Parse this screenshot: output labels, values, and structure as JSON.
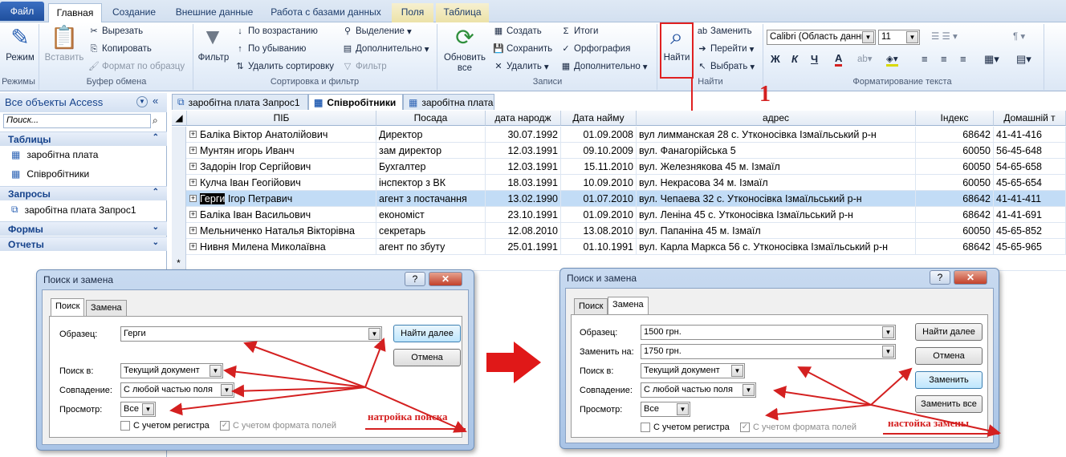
{
  "ribbon_tabs": [
    "Файл",
    "Главная",
    "Создание",
    "Внешние данные",
    "Работа с базами данных",
    "Поля",
    "Таблица"
  ],
  "ribbon": {
    "mode_label": "Режим",
    "paste_label": "Вставить",
    "cut": "Вырезать",
    "copy": "Копировать",
    "format_painter": "Формат по образцу",
    "filter_label": "Фильтр",
    "sort_asc": "По возрастанию",
    "sort_desc": "По убыванию",
    "remove_sort": "Удалить сортировку",
    "selection": "Выделение",
    "advanced": "Дополнительно",
    "toggle_filter": "Фильтр",
    "refresh_label": "Обновить все",
    "create": "Создать",
    "save": "Сохранить",
    "delete": "Удалить",
    "totals": "Итоги",
    "spelling": "Орфография",
    "more": "Дополнительно",
    "find_label": "Найти",
    "replace": "Заменить",
    "goto": "Перейти",
    "select": "Выбрать",
    "font_name": "Calibri (Область данны",
    "font_size": "11",
    "bold": "Ж",
    "italic": "К",
    "underline": "Ч",
    "font_color_glyph": "А",
    "groups": {
      "modes": "Режимы",
      "clipboard": "Буфер обмена",
      "sort_filter": "Сортировка и фильтр",
      "records": "Записи",
      "find": "Найти",
      "text_format": "Форматирование текста"
    }
  },
  "nav": {
    "header": "Все объекты Access",
    "search_placeholder": "Поиск...",
    "sections": {
      "tables": "Таблицы",
      "queries": "Запросы",
      "forms": "Формы",
      "reports": "Отчеты"
    },
    "tables": [
      "заробітна плата",
      "Співробітники"
    ],
    "queries": [
      "заробітна плата Запрос1"
    ]
  },
  "doc_tabs": [
    "заробітна плата Запрос1",
    "Співробітники",
    "заробітна плата"
  ],
  "grid": {
    "columns": [
      "ПІБ",
      "Посада",
      "дата народж",
      "Дата найму",
      "адрес",
      "Індекс",
      "Домашній т"
    ],
    "rows": [
      {
        "pib": "Баліка Віктор Анатолійович",
        "pos": "Директор",
        "dob": "30.07.1992",
        "hired": "01.09.2008",
        "addr": "вул лимманская 28  с. Утконосівка Ізмаїльський р-н",
        "idx": "68642",
        "tel": "41-41-416"
      },
      {
        "pib": "Мунтян игорь Иванч",
        "pos": "зам директор",
        "dob": "12.03.1991",
        "hired": "09.10.2009",
        "addr": "вул. Фанагорійська 5",
        "idx": "60050",
        "tel": "56-45-648"
      },
      {
        "pib": "Задорін Ігор Сергійович",
        "pos": "Бухгалтер",
        "dob": "12.03.1991",
        "hired": "15.11.2010",
        "addr": "вул. Железнякова 45  м. Ізмаїл",
        "idx": "60050",
        "tel": "54-65-658"
      },
      {
        "pib": "Кулча Іван Геогійович",
        "pos": "інспектор з ВК",
        "dob": "18.03.1991",
        "hired": "10.09.2010",
        "addr": "вул. Некрасова 34 м. Ізмаїл",
        "idx": "60050",
        "tel": "45-65-654"
      },
      {
        "pib_hl": "Герги",
        "pib_rest": " Ігор Петравич",
        "pos": "агент з постачання",
        "dob": "13.02.1990",
        "hired": "01.07.2010",
        "addr": "вул. Чепаева 32 с. Утконосівка Ізмаїльський р-н",
        "idx": "68642",
        "tel": "41-41-411"
      },
      {
        "pib": "Баліка Іван Васильович",
        "pos": "економіст",
        "dob": "23.10.1991",
        "hired": "01.09.2010",
        "addr": "вул. Леніна 45 с. Утконосівка Ізмаїльський р-н",
        "idx": "68642",
        "tel": "41-41-691"
      },
      {
        "pib": "Мельниченко Наталья Вікторівна",
        "pos": "секретарь",
        "dob": "12.08.2010",
        "hired": "13.08.2010",
        "addr": "вул. Папаніна 45 м. Ізмаїл",
        "idx": "60050",
        "tel": "45-65-852"
      },
      {
        "pib": "Нивня Милена Миколаївна",
        "pos": "агент по збуту",
        "dob": "25.01.1991",
        "hired": "01.10.1991",
        "addr": "вул. Карла Маркса 56 с. Утконосівка Ізмаїльський р-н",
        "idx": "68642",
        "tel": "45-65-965"
      }
    ],
    "new_row_marker": "*"
  },
  "find_dialog": {
    "title": "Поиск и замена",
    "tab_find": "Поиск",
    "tab_replace": "Замена",
    "sample_label": "Образец:",
    "sample_value": "Герги",
    "lookin_label": "Поиск в:",
    "lookin_value": "Текущий документ",
    "match_label": "Совпадение:",
    "match_value": "С любой частью поля",
    "search_label": "Просмотр:",
    "search_value": "Все",
    "case_label": "С учетом регистра",
    "format_label": "С учетом формата полей",
    "find_next": "Найти далее",
    "cancel": "Отмена",
    "help": "?",
    "close": "✕"
  },
  "replace_dialog": {
    "title": "Поиск и замена",
    "tab_find": "Поиск",
    "tab_replace": "Замена",
    "sample_label": "Образец:",
    "sample_value": "1500 грн.",
    "replace_label": "Заменить на:",
    "replace_value": "1750 грн.",
    "lookin_label": "Поиск в:",
    "lookin_value": "Текущий документ",
    "match_label": "Совпадение:",
    "match_value": "С любой частью поля",
    "search_label": "Просмотр:",
    "search_value": "Все",
    "case_label": "С учетом регистра",
    "format_label": "С учетом формата полей",
    "find_next": "Найти далее",
    "cancel": "Отмена",
    "replace_btn": "Заменить",
    "replace_all": "Заменить все",
    "help": "?",
    "close": "✕"
  },
  "annotations": {
    "number": "1",
    "find_note": "натройка поиска",
    "replace_note": "настойка замены",
    "color": "#d42020"
  }
}
